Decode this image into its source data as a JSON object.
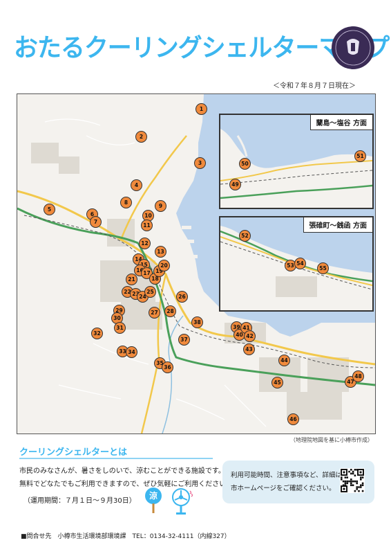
{
  "title": "おたるクーリングシェルターマップ",
  "as_of": "＜令和７年８月７日現在＞",
  "credit": "（地理院地図を基に小樽市作成）",
  "insets": [
    {
      "label": "蘭島～塩谷 方面"
    },
    {
      "label": "張碓町～銭函 方面"
    }
  ],
  "pins": [
    "1",
    "2",
    "3",
    "4",
    "5",
    "6",
    "7",
    "8",
    "9",
    "10",
    "11",
    "12",
    "13",
    "14",
    "15",
    "16",
    "17",
    "18",
    "19",
    "20",
    "21",
    "22",
    "23",
    "24",
    "25",
    "26",
    "27",
    "28",
    "29",
    "30",
    "31",
    "32",
    "33",
    "34",
    "35",
    "36",
    "37",
    "38",
    "39",
    "40",
    "41",
    "42",
    "43",
    "44",
    "45",
    "46",
    "47",
    "48",
    "49",
    "50",
    "51",
    "52",
    "53",
    "54",
    "55"
  ],
  "about": {
    "heading": "クーリングシェルターとは",
    "line1": "市民のみなさんが、暑さをしのいで、涼むことができる施設です。",
    "line2": "無料でどなたでもご利用できますので、ぜひ気軽にご利用ください！",
    "period": "（運用期間：７月１日～９月30日）",
    "icon_char": "涼"
  },
  "contact": {
    "line1": "利用可能時間、注意事項など、詳細は",
    "line2": "市ホームページをご確認ください。"
  },
  "footer": "■問合せ先　小樽市生活環境部環境課　TEL：0134-32-4111（内線327）",
  "colors": {
    "title": "#3cb6ef",
    "pin": "#f08a3c",
    "sea": "#bcd3ec",
    "road_main": "#4aa05a",
    "road_yellow": "#f2c84b"
  }
}
